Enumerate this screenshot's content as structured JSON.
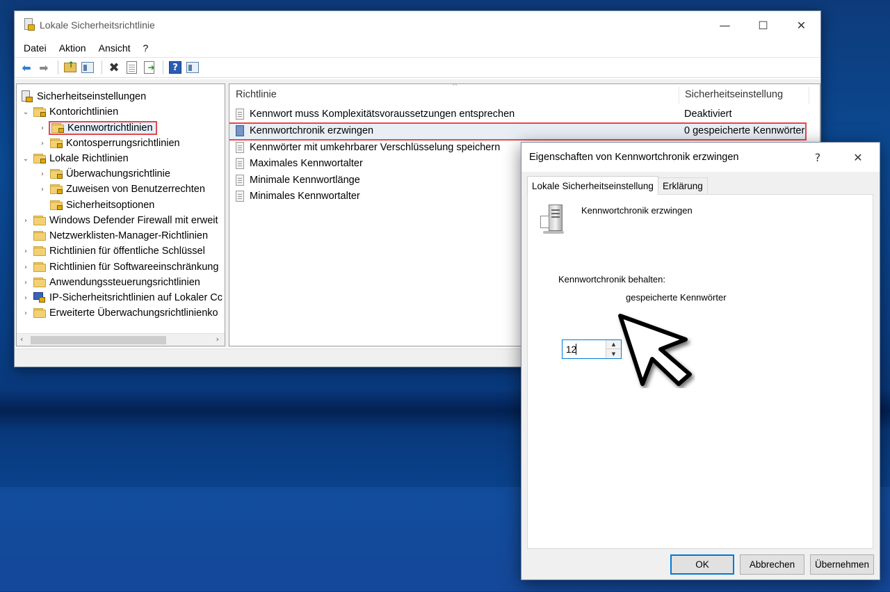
{
  "main_window": {
    "title": "Lokale Sicherheitsrichtlinie",
    "controls": {
      "minimize": "—",
      "maximize": "☐",
      "close": "✕"
    },
    "menu": [
      "Datei",
      "Aktion",
      "Ansicht",
      "?"
    ],
    "toolbar_icons": [
      "back-icon",
      "forward-icon",
      "up-folder-icon",
      "show-hide-tree-icon",
      "delete-icon",
      "properties-icon",
      "export-list-icon",
      "help-icon",
      "view-icon"
    ]
  },
  "tree": {
    "root": "Sicherheitseinstellungen",
    "items": [
      {
        "label": "Kontorichtlinien",
        "expander": "⌄"
      },
      {
        "label": "Kennwortrichtlinien",
        "expander": "›",
        "selected": true
      },
      {
        "label": "Kontosperrungsrichtlinien",
        "expander": "›"
      },
      {
        "label": "Lokale Richtlinien",
        "expander": "⌄"
      },
      {
        "label": "Überwachungsrichtlinie",
        "expander": "›"
      },
      {
        "label": "Zuweisen von Benutzerrechten",
        "expander": "›"
      },
      {
        "label": "Sicherheitsoptionen",
        "expander": ""
      },
      {
        "label": "Windows Defender Firewall mit erweit",
        "expander": "›"
      },
      {
        "label": "Netzwerklisten-Manager-Richtlinien",
        "expander": ""
      },
      {
        "label": "Richtlinien für öffentliche Schlüssel",
        "expander": "›"
      },
      {
        "label": "Richtlinien für Softwareeinschränkung",
        "expander": "›"
      },
      {
        "label": "Anwendungssteuerungsrichtlinien",
        "expander": "›"
      },
      {
        "label": "IP-Sicherheitsrichtlinien auf Lokaler Cc",
        "expander": "›"
      },
      {
        "label": "Erweiterte Überwachungsrichtlinienko",
        "expander": "›"
      }
    ],
    "scroll_left": "‹",
    "scroll_right": "›"
  },
  "list": {
    "columns": {
      "policy": "Richtlinie",
      "setting": "Sicherheitseinstellung"
    },
    "sort_indicator": "^",
    "rows": [
      {
        "policy": "Kennwort muss Komplexitätsvoraussetzungen entsprechen",
        "setting": "Deaktiviert"
      },
      {
        "policy": "Kennwortchronik erzwingen",
        "setting": "0 gespeicherte Kennwörter",
        "selected": true
      },
      {
        "policy": "Kennwörter mit umkehrbarer Verschlüsselung speichern",
        "setting": ""
      },
      {
        "policy": "Maximales Kennwortalter",
        "setting": ""
      },
      {
        "policy": "Minimale Kennwortlänge",
        "setting": ""
      },
      {
        "policy": "Minimales Kennwortalter",
        "setting": ""
      }
    ]
  },
  "dialog": {
    "title": "Eigenschaften von Kennwortchronik erzwingen",
    "help": "?",
    "close": "✕",
    "tabs": [
      "Lokale Sicherheitseinstellung",
      "Erklärung"
    ],
    "policy_name": "Kennwortchronik erzwingen",
    "field_label": "Kennwortchronik behalten:",
    "field_value": "12",
    "field_suffix": "gespeicherte Kennwörter",
    "spin_up": "▲",
    "spin_down": "▼",
    "buttons": {
      "ok": "OK",
      "cancel": "Abbrechen",
      "apply": "Übernehmen"
    }
  }
}
